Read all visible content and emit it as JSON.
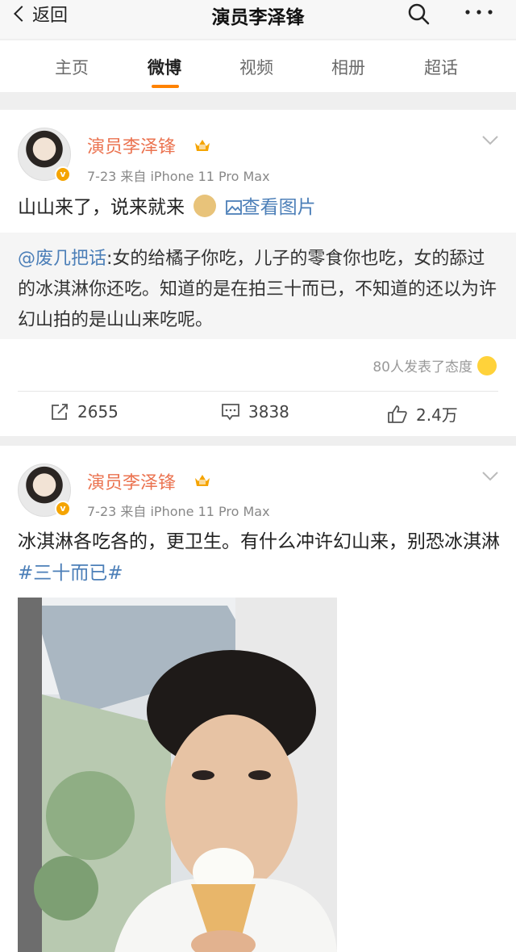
{
  "header": {
    "back_label": "返回",
    "title": "演员李泽锋"
  },
  "tabs": [
    {
      "label": "主页"
    },
    {
      "label": "微博"
    },
    {
      "label": "视频"
    },
    {
      "label": "相册"
    },
    {
      "label": "超话"
    }
  ],
  "active_tab": "微博",
  "colors": {
    "accent": "#ff8200",
    "username": "#eb7350",
    "link": "#4c7fb8"
  },
  "posts": [
    {
      "username": "演员李泽锋",
      "meta": "7-23  来自 iPhone 11 Pro Max",
      "text": "山山来了，说来就来",
      "view_image": "查看图片",
      "quote_user": "@废几把话",
      "quote_text": ":女的给橘子你吃，儿子的零食你也吃，女的舔过的冰淇淋你还吃。知道的是在拍三十而已，不知道的还以为许幻山拍的是山山来吃呢。",
      "reactions": "80人发表了态度",
      "reposts": "2655",
      "comments": "3838",
      "likes": "2.4万"
    },
    {
      "username": "演员李泽锋",
      "meta": "7-23  来自 iPhone 11 Pro Max",
      "text": "冰淇淋各吃各的，更卫生。有什么冲许幻山来，别恐冰淇淋",
      "hashtag": "#三十而已#"
    }
  ]
}
